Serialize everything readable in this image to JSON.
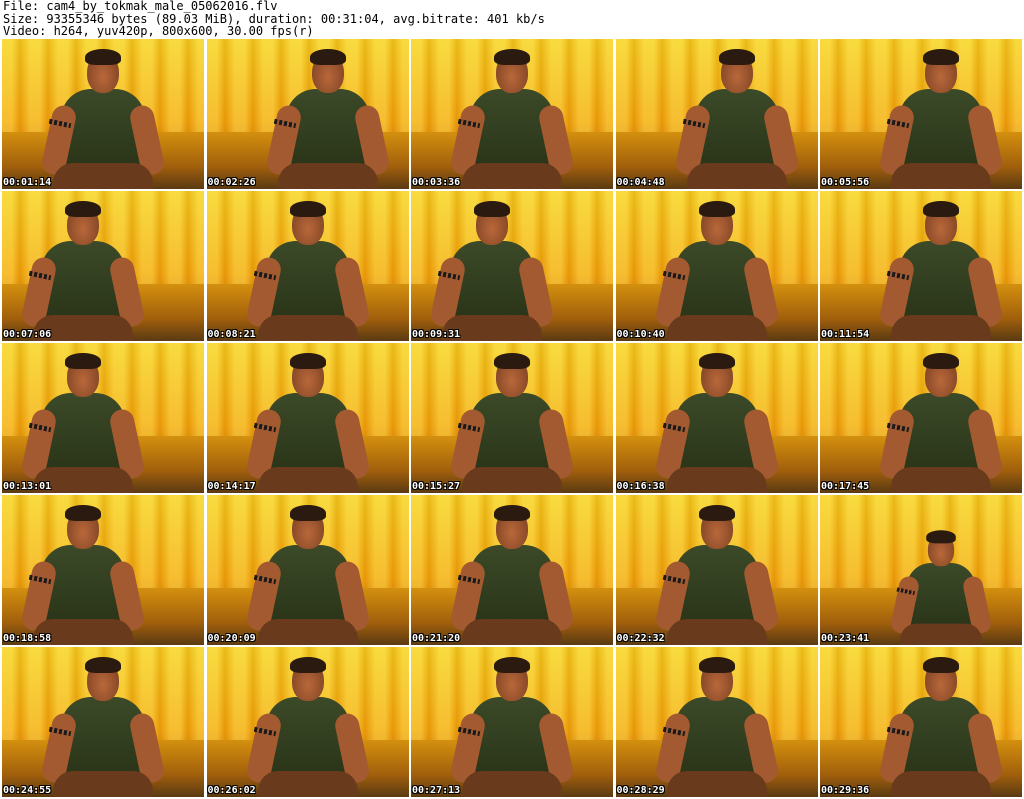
{
  "header": {
    "file_line": "File: cam4_by_tokmak_male_05062016.flv",
    "size_line": "Size: 93355346 bytes (89.03 MiB), duration: 00:31:04, avg.bitrate: 401 kb/s",
    "video_line": "Video: h264, yuv420p, 800x600, 30.00 fps(r)"
  },
  "thumbnails": [
    {
      "timestamp": "00:01:14"
    },
    {
      "timestamp": "00:02:26"
    },
    {
      "timestamp": "00:03:36"
    },
    {
      "timestamp": "00:04:48"
    },
    {
      "timestamp": "00:05:56"
    },
    {
      "timestamp": "00:07:06"
    },
    {
      "timestamp": "00:08:21"
    },
    {
      "timestamp": "00:09:31"
    },
    {
      "timestamp": "00:10:40"
    },
    {
      "timestamp": "00:11:54"
    },
    {
      "timestamp": "00:13:01"
    },
    {
      "timestamp": "00:14:17"
    },
    {
      "timestamp": "00:15:27"
    },
    {
      "timestamp": "00:16:38"
    },
    {
      "timestamp": "00:17:45"
    },
    {
      "timestamp": "00:18:58"
    },
    {
      "timestamp": "00:20:09"
    },
    {
      "timestamp": "00:21:20"
    },
    {
      "timestamp": "00:22:32"
    },
    {
      "timestamp": "00:23:41"
    },
    {
      "timestamp": "00:24:55"
    },
    {
      "timestamp": "00:26:02"
    },
    {
      "timestamp": "00:27:13"
    },
    {
      "timestamp": "00:28:29"
    },
    {
      "timestamp": "00:29:36"
    }
  ],
  "colors": {
    "background": "#ffffff",
    "text": "#000000",
    "timestamp": "#ffffff"
  }
}
